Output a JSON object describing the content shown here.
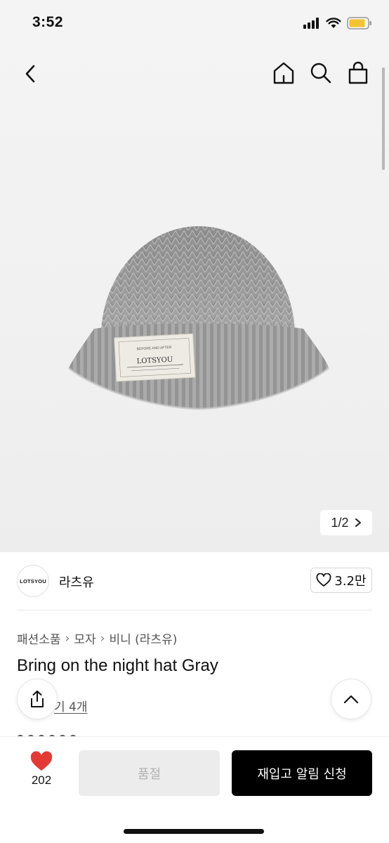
{
  "status_bar": {
    "time": "3:52"
  },
  "gallery": {
    "counter": "1/2",
    "label_text": [
      "BEFORE AND AFTER",
      "LOTSYOU"
    ]
  },
  "brand": {
    "logo_text": "LOTSYOU",
    "name": "라츠유",
    "likes": "3.2만"
  },
  "breadcrumb": [
    "패션소품",
    "모자",
    "비니 (라츠유)"
  ],
  "product": {
    "title": "Bring on the night hat Gray",
    "review_link": "기 4개"
  },
  "bottom": {
    "wish_count": "202",
    "soldout_label": "품절",
    "restock_label": "재입고 알림 신청"
  },
  "colors": {
    "accent_heart": "#e53935",
    "primary_button": "#000000"
  },
  "icons": [
    "back-icon",
    "home-icon",
    "search-icon",
    "bag-icon",
    "heart-icon",
    "share-icon",
    "chevron-up-icon",
    "chevron-right-icon"
  ]
}
